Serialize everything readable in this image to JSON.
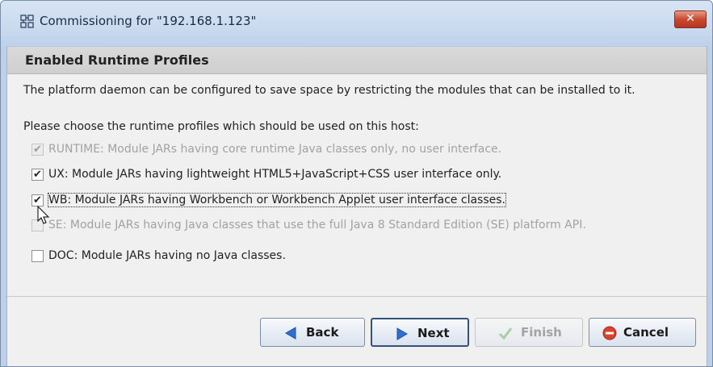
{
  "window": {
    "title": "Commissioning for \"192.168.1.123\"",
    "close_label": "✕"
  },
  "header": {
    "title": "Enabled Runtime Profiles"
  },
  "description": "The platform daemon can be configured to save space by restricting the modules that can be installed to it.",
  "prompt": "Please choose the runtime profiles which should be used on this host:",
  "options": [
    {
      "label": "RUNTIME: Module JARs having core runtime Java classes only, no user interface.",
      "checked": true,
      "enabled": false
    },
    {
      "label": "UX: Module JARs having lightweight HTML5+JavaScript+CSS user interface only.",
      "checked": true,
      "enabled": true
    },
    {
      "label": "WB: Module JARs having Workbench or Workbench Applet user interface classes.",
      "checked": true,
      "enabled": true,
      "focused": true
    },
    {
      "label": "SE: Module JARs having Java classes that use the full Java 8 Standard Edition (SE) platform API.",
      "checked": false,
      "enabled": false
    },
    {
      "label": "DOC: Module JARs having no Java classes.",
      "checked": false,
      "enabled": true
    }
  ],
  "check_glyph": "✔",
  "buttons": {
    "back": "Back",
    "next": "Next",
    "finish": "Finish",
    "cancel": "Cancel"
  },
  "colors": {
    "accent_blue": "#2f6fd0",
    "cancel_red": "#d9432d",
    "finish_green_disabled": "#a9cfa0"
  }
}
